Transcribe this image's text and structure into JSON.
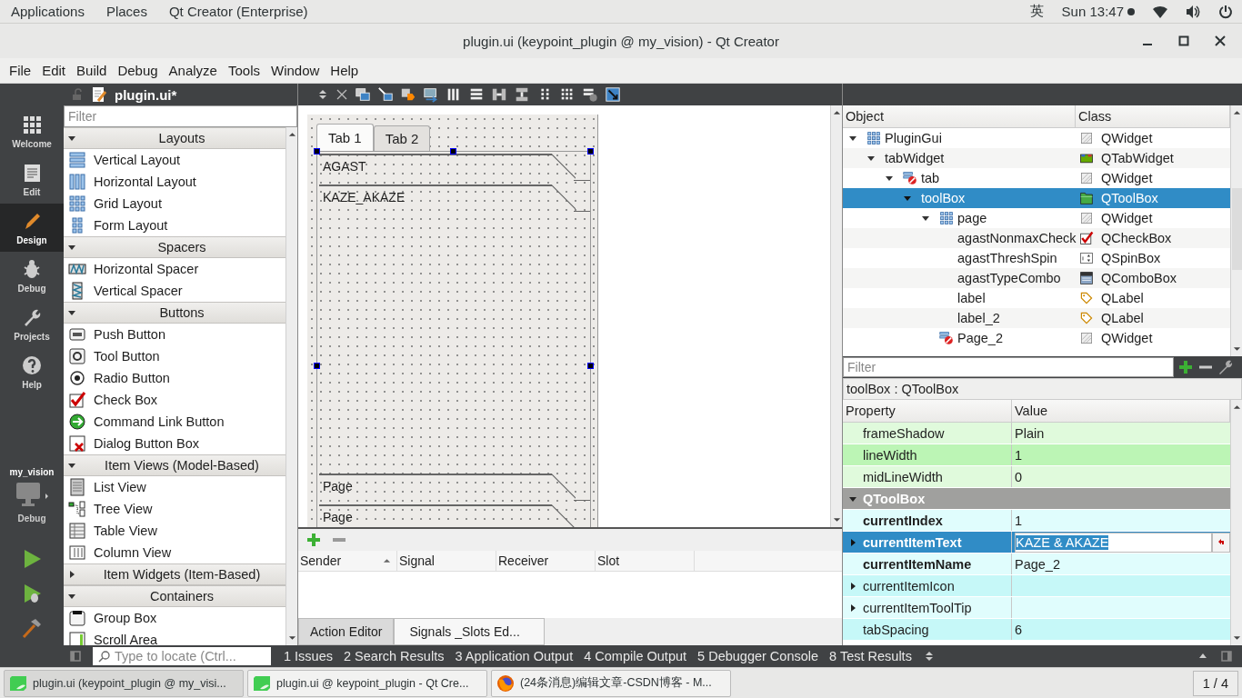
{
  "top_bar": {
    "menus": [
      "Applications",
      "Places",
      "Qt Creator (Enterprise)"
    ],
    "input_method": "英",
    "clock": "Sun 13:47"
  },
  "window": {
    "title": "plugin.ui (keypoint_plugin @ my_vision) - Qt Creator"
  },
  "menu_bar": [
    "File",
    "Edit",
    "Build",
    "Debug",
    "Analyze",
    "Tools",
    "Window",
    "Help"
  ],
  "modes": [
    {
      "label": "Welcome",
      "selected": false
    },
    {
      "label": "Edit",
      "selected": false
    },
    {
      "label": "Design",
      "selected": true
    },
    {
      "label": "Debug",
      "selected": false
    },
    {
      "label": "Projects",
      "selected": false
    },
    {
      "label": "Help",
      "selected": false
    }
  ],
  "kit": {
    "project": "my_vision",
    "build": "Debug"
  },
  "document": {
    "title": "plugin.ui*"
  },
  "widget_box": {
    "filter": {
      "placeholder": "Filter"
    },
    "groups": [
      {
        "title": "Layouts",
        "expanded": true,
        "items": [
          {
            "label": "Vertical Layout",
            "kind": "vlayout"
          },
          {
            "label": "Horizontal Layout",
            "kind": "hlayout"
          },
          {
            "label": "Grid Layout",
            "kind": "grid"
          },
          {
            "label": "Form Layout",
            "kind": "form"
          }
        ]
      },
      {
        "title": "Spacers",
        "expanded": true,
        "items": [
          {
            "label": "Horizontal Spacer",
            "kind": "hspacer"
          },
          {
            "label": "Vertical Spacer",
            "kind": "vspacer"
          }
        ]
      },
      {
        "title": "Buttons",
        "expanded": true,
        "items": [
          {
            "label": "Push Button",
            "kind": "push"
          },
          {
            "label": "Tool Button",
            "kind": "tool"
          },
          {
            "label": "Radio Button",
            "kind": "radio"
          },
          {
            "label": "Check Box",
            "kind": "check"
          },
          {
            "label": "Command Link Button",
            "kind": "link"
          },
          {
            "label": "Dialog Button Box",
            "kind": "dialog"
          }
        ]
      },
      {
        "title": "Item Views (Model-Based)",
        "expanded": true,
        "items": [
          {
            "label": "List View",
            "kind": "list"
          },
          {
            "label": "Tree View",
            "kind": "tree"
          },
          {
            "label": "Table View",
            "kind": "table"
          },
          {
            "label": "Column View",
            "kind": "column"
          }
        ]
      },
      {
        "title": "Item Widgets (Item-Based)",
        "expanded": false
      },
      {
        "title": "Containers",
        "expanded": true,
        "items": [
          {
            "label": "Group Box",
            "kind": "group"
          },
          {
            "label": "Scroll Area",
            "kind": "scroll"
          }
        ]
      }
    ]
  },
  "form": {
    "tabs": [
      {
        "label": "Tab 1",
        "selected": true
      },
      {
        "label": "Tab 2",
        "selected": false
      }
    ],
    "toolbox_pages_top": [
      {
        "label": "AGAST"
      },
      {
        "label": "KAZE_AKAZE"
      }
    ],
    "toolbox_pages_bottom": [
      {
        "label": "Page"
      },
      {
        "label": "Page"
      }
    ]
  },
  "signals_editor": {
    "columns": [
      "Sender",
      "Signal",
      "Receiver",
      "Slot"
    ],
    "tabs": [
      {
        "label": "Action Editor",
        "selected": false
      },
      {
        "label": "Signals _Slots Ed...",
        "selected": true
      }
    ]
  },
  "object_inspector": {
    "columns": [
      "Object",
      "Class"
    ],
    "tree": [
      {
        "name": "PluginGui",
        "class": "QWidget",
        "kind": "widget",
        "laid_out": true,
        "expanded": true,
        "selected": false,
        "children": [
          {
            "name": "tabWidget",
            "class": "QTabWidget",
            "kind": "tabwidget",
            "expanded": true,
            "selected": false,
            "children": [
              {
                "name": "tab",
                "class": "QWidget",
                "kind": "widget",
                "laid_out": false,
                "expanded": true,
                "selected": false,
                "children": [
                  {
                    "name": "toolBox",
                    "class": "QToolBox",
                    "kind": "toolbox",
                    "expanded": true,
                    "selected": true,
                    "children": [
                      {
                        "name": "page",
                        "class": "QWidget",
                        "kind": "widget",
                        "laid_out": true,
                        "expanded": true,
                        "selected": false,
                        "children": [
                          {
                            "name": "agastNonmaxCheck",
                            "class": "QCheckBox",
                            "kind": "checkbox",
                            "selected": false
                          },
                          {
                            "name": "agastThreshSpin",
                            "class": "QSpinBox",
                            "kind": "spinbox",
                            "selected": false
                          },
                          {
                            "name": "agastTypeCombo",
                            "class": "QComboBox",
                            "kind": "combobox",
                            "selected": false
                          },
                          {
                            "name": "label",
                            "class": "QLabel",
                            "kind": "label",
                            "selected": false
                          },
                          {
                            "name": "label_2",
                            "class": "QLabel",
                            "kind": "label",
                            "selected": false
                          }
                        ]
                      },
                      {
                        "name": "Page_2",
                        "class": "QWidget",
                        "kind": "widget",
                        "laid_out": false,
                        "selected": false
                      }
                    ]
                  }
                ]
              }
            ]
          }
        ]
      }
    ]
  },
  "property_editor": {
    "filter": {
      "placeholder": "Filter"
    },
    "object": "toolBox : QToolBox",
    "columns": [
      "Property",
      "Value"
    ],
    "rows": [
      {
        "kind": "property",
        "name": "frameShadow",
        "value": "Plain",
        "color": "#e0fadc",
        "changed": false,
        "expandable": false,
        "selected": false
      },
      {
        "kind": "property",
        "name": "lineWidth",
        "value": "1",
        "color": "#bcf5b5",
        "changed": false,
        "expandable": false,
        "selected": false
      },
      {
        "kind": "property",
        "name": "midLineWidth",
        "value": "0",
        "color": "#e0fadc",
        "changed": false,
        "expandable": false,
        "selected": false
      },
      {
        "kind": "group",
        "name": "QToolBox",
        "expanded": true
      },
      {
        "kind": "property",
        "name": "currentIndex",
        "value": "1",
        "color": "#e0fdfd",
        "changed": true,
        "expandable": false,
        "selected": false
      },
      {
        "kind": "property",
        "name": "currentItemText",
        "value": "KAZE & AKAZE",
        "changed": true,
        "expandable": true,
        "selected": true
      },
      {
        "kind": "property",
        "name": "currentItemName",
        "value": "Page_2",
        "color": "#e0fdfd",
        "changed": true,
        "expandable": false,
        "selected": false
      },
      {
        "kind": "property",
        "name": "currentItemIcon",
        "color": "#c6f8f8",
        "changed": false,
        "expandable": true,
        "selected": false
      },
      {
        "kind": "property",
        "name": "currentItemToolTip",
        "color": "#e0fdfd",
        "changed": false,
        "expandable": true,
        "selected": false
      },
      {
        "kind": "property",
        "name": "tabSpacing",
        "value": "6",
        "color": "#c6f8f8",
        "changed": false,
        "expandable": false,
        "selected": false
      }
    ]
  },
  "output_bar": {
    "locator": {
      "placeholder": "Type to locate (Ctrl..."
    },
    "panes": [
      "1 Issues",
      "2 Search Results",
      "3 Application Output",
      "4 Compile Output",
      "5 Debugger Console",
      "8 Test Results"
    ]
  },
  "taskbar": {
    "windows": [
      {
        "label": "plugin.ui (keypoint_plugin @ my_visi...",
        "kind": "qt",
        "selected": true
      },
      {
        "label": "plugin.ui @ keypoint_plugin - Qt Cre...",
        "kind": "qt",
        "selected": false
      },
      {
        "label": "(24条消息)编辑文章-CSDN博客 - M...",
        "kind": "browser",
        "selected": false
      }
    ],
    "workspace": "1 / 4"
  }
}
